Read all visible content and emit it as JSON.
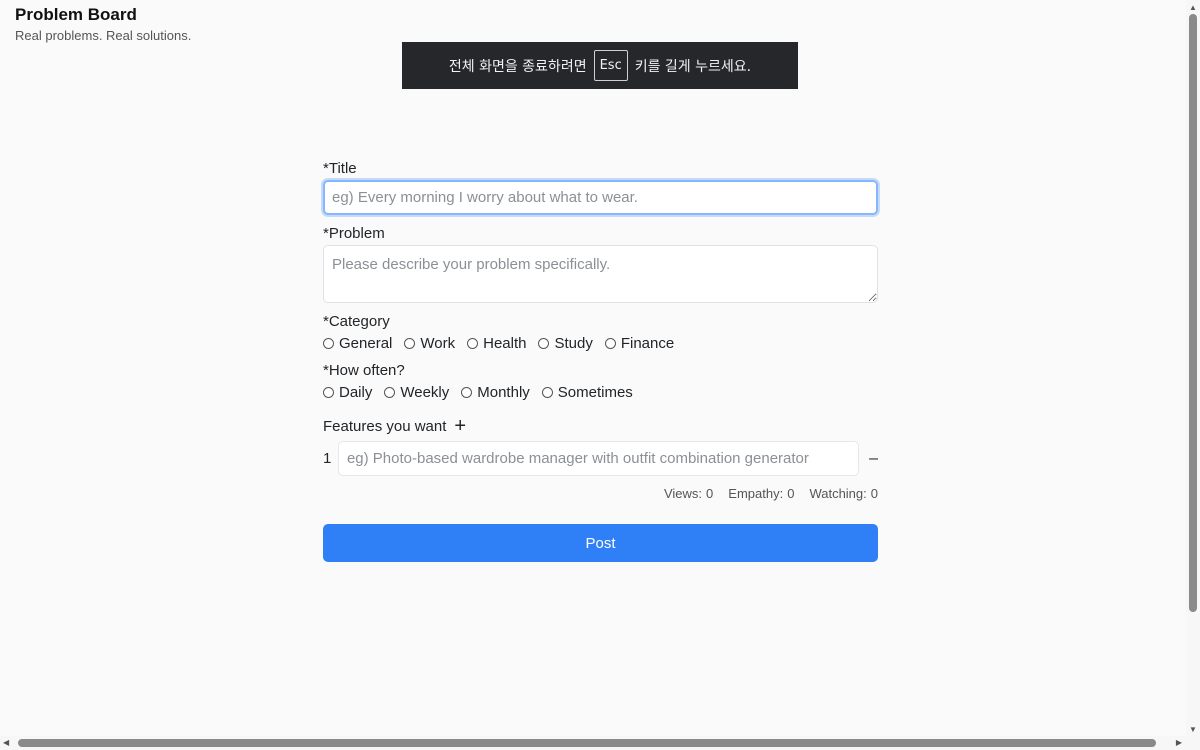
{
  "brand": {
    "title": "Problem Board",
    "subtitle": "Real problems. Real solutions."
  },
  "fullscreen_notice": {
    "before": "전체 화면을 종료하려면",
    "key": "Esc",
    "after": "키를 길게 누르세요."
  },
  "form": {
    "title_label": "*Title",
    "title_placeholder": "eg) Every morning I worry about what to wear.",
    "problem_label": "*Problem",
    "problem_placeholder": "Please describe your problem specifically.",
    "category_label": "*Category",
    "categories": [
      "General",
      "Work",
      "Health",
      "Study",
      "Finance"
    ],
    "frequency_label": "*How often?",
    "frequencies": [
      "Daily",
      "Weekly",
      "Monthly",
      "Sometimes"
    ],
    "features_label": "Features you want",
    "add_feature_symbol": "+",
    "features": [
      {
        "index": "1",
        "placeholder": "eg) Photo-based wardrobe manager with outfit combination generator",
        "remove_symbol": "–"
      }
    ],
    "post_label": "Post"
  },
  "stats": {
    "views_label": "Views:",
    "views": "0",
    "empathy_label": "Empathy:",
    "empathy": "0",
    "watching_label": "Watching:",
    "watching": "0"
  },
  "colors": {
    "accent": "#2f80f7",
    "focus_ring": "#86b7fe",
    "background": "#fafafa",
    "banner_bg": "#25272a"
  }
}
